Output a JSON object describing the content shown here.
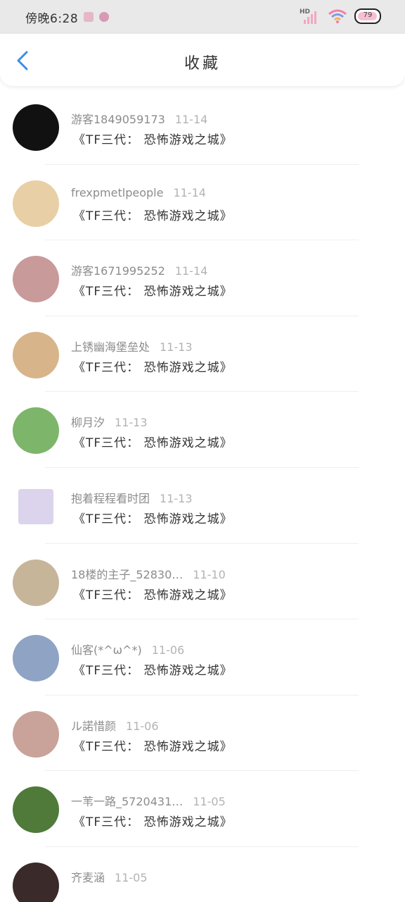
{
  "status_bar": {
    "time": "傍晚6:28",
    "hd_label": "HD",
    "battery_level": "79"
  },
  "header": {
    "title": "收藏"
  },
  "favorites": [
    {
      "user": "游客1849059173",
      "date": "11-14",
      "title": "《TF三代： 恐怖游戏之城》",
      "avatar_color": "#111111"
    },
    {
      "user": "frexpmetlpeople",
      "date": "11-14",
      "title": "《TF三代： 恐怖游戏之城》",
      "avatar_color": "#e9cfa5"
    },
    {
      "user": "游客1671995252",
      "date": "11-14",
      "title": "《TF三代： 恐怖游戏之城》",
      "avatar_color": "#c99a9a"
    },
    {
      "user": "上锈幽海堡垒处",
      "date": "11-13",
      "title": "《TF三代： 恐怖游戏之城》",
      "avatar_color": "#d8b48a"
    },
    {
      "user": "柳月汐",
      "date": "11-13",
      "title": "《TF三代： 恐怖游戏之城》",
      "avatar_color": "#7db56a"
    },
    {
      "user": "抱着程程看时团",
      "date": "11-13",
      "title": "《TF三代： 恐怖游戏之城》",
      "avatar_color": "#dcd3ec"
    },
    {
      "user": "18楼的主子_52830…",
      "date": "11-10",
      "title": "《TF三代： 恐怖游戏之城》",
      "avatar_color": "#c7b59a"
    },
    {
      "user": "仙客(*^ω^*)",
      "date": "11-06",
      "title": "《TF三代： 恐怖游戏之城》",
      "avatar_color": "#8fa3c4"
    },
    {
      "user": "ル諾惜颜",
      "date": "11-06",
      "title": "《TF三代： 恐怖游戏之城》",
      "avatar_color": "#c9a29a"
    },
    {
      "user": "一苇一路_5720431…",
      "date": "11-05",
      "title": "《TF三代： 恐怖游戏之城》",
      "avatar_color": "#4f7a3a"
    },
    {
      "user": "齐麦涵",
      "date": "11-05",
      "title": "",
      "avatar_color": "#3a2a2a"
    }
  ]
}
